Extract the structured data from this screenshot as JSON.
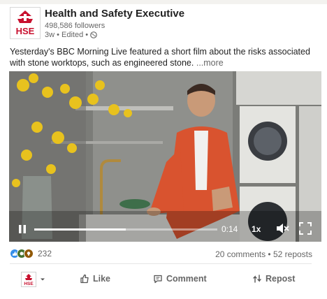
{
  "post": {
    "org_name": "Health and Safety Executive",
    "logo_text": "HSE",
    "followers": "498,586 followers",
    "meta": "3w • Edited •",
    "text": "Yesterday's BBC Morning Live featured a short film about the risks associated with stone worktops, such as engineered stone.",
    "more": "...more"
  },
  "video": {
    "time": "0:14",
    "speed": "1x",
    "progress": 0.5
  },
  "social": {
    "reaction_count": "232",
    "stats": "20 comments • 52 reposts"
  },
  "actions": {
    "like": "Like",
    "comment": "Comment",
    "repost": "Repost"
  },
  "colors": {
    "hse_red": "#c8102e",
    "like_blue": "#378fe9",
    "celebrate_green": "#44712e",
    "insight_purple": "#915907"
  },
  "icons": [
    "globe-icon",
    "pause-icon",
    "mute-icon",
    "fullscreen-icon",
    "like-icon",
    "comment-icon",
    "repost-icon",
    "chevron-down-icon"
  ]
}
